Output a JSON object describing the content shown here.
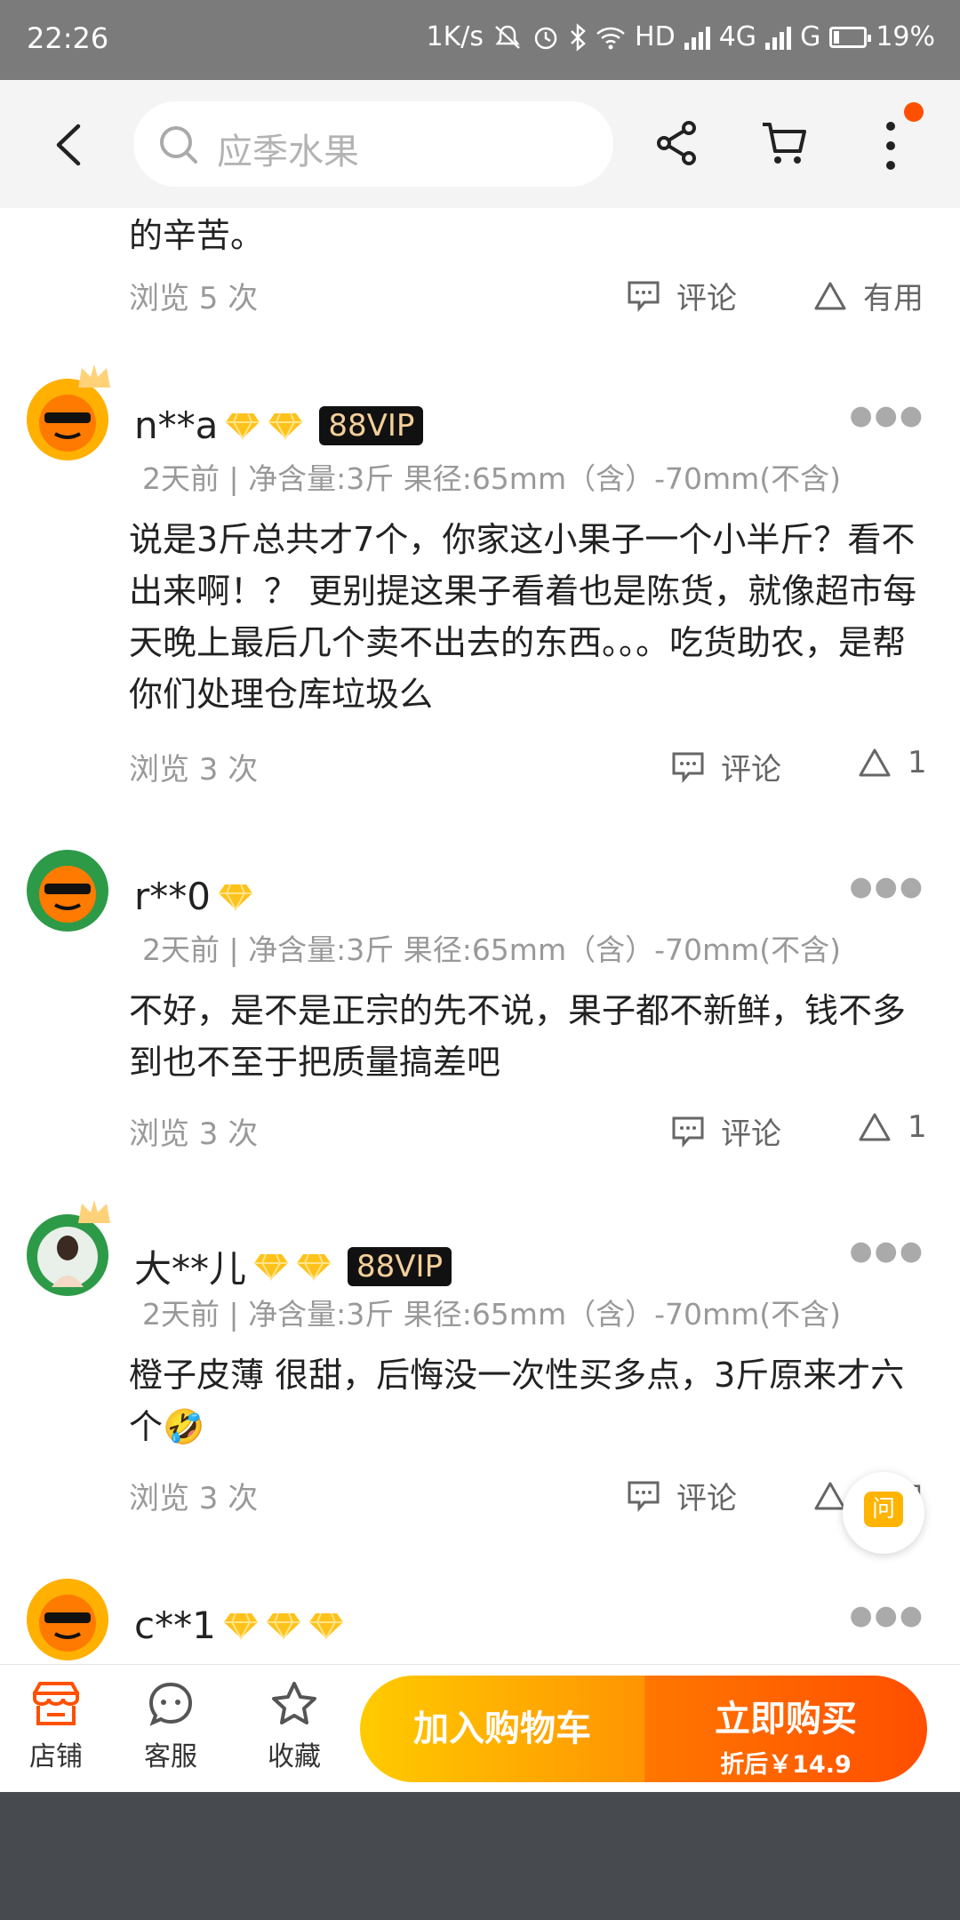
{
  "status_bar": {
    "time": "22:26",
    "net_speed": "1K/s",
    "hd": "HD",
    "net1": "4G",
    "net2": "G",
    "battery": "19%",
    "battery_level": 0.19
  },
  "header": {
    "search_placeholder": "应季水果",
    "icons": [
      "back-icon",
      "search-icon",
      "share-icon",
      "cart-icon",
      "more-icon"
    ]
  },
  "fragment": {
    "text": "的辛苦。",
    "views": "浏览 5 次",
    "comment": "评论",
    "useful": "有用"
  },
  "reviews": [
    {
      "user": "n**a",
      "vip": "88VIP",
      "meta": "2天前 | 净含量:3斤 果径:65mm（含）-70mm(不含)",
      "text": "说是3斤总共才7个，你家这小果子一个小半斤？看不出来啊！？ 更别提这果子看着也是陈货，就像超市每天晚上最后几个卖不出去的东西。。。吃货助农，是帮你们处理仓库垃圾么",
      "views": "浏览 3 次",
      "comment": "评论",
      "useful": "1"
    },
    {
      "user": "r**0",
      "vip": "",
      "meta": "2天前 | 净含量:3斤 果径:65mm（含）-70mm(不含)",
      "text": "不好，是不是正宗的先不说，果子都不新鲜，钱不多到也不至于把质量搞差吧",
      "views": "浏览 3 次",
      "comment": "评论",
      "useful": "1"
    },
    {
      "user": "大**儿",
      "vip": "88VIP",
      "meta": "2天前 | 净含量:3斤 果径:65mm（含）-70mm(不含)",
      "text": "橙子皮薄 很甜，后悔没一次性买多点，3斤原来才六个🤣",
      "views": "浏览 3 次",
      "comment": "评论",
      "useful": "有用"
    },
    {
      "user": "c**1",
      "vip": "",
      "meta": "",
      "text": "",
      "views": "",
      "comment": "",
      "useful": ""
    }
  ],
  "float_ask": "问",
  "bottom": {
    "shop": "店铺",
    "service": "客服",
    "favorite": "收藏",
    "add_cart": "加入购物车",
    "buy_now": "立即购买",
    "discount_price": "折后￥14.9"
  },
  "colors": {
    "accent": "#ff5000",
    "cart_button": "#ffa800",
    "buy_button": "#ff6000"
  }
}
